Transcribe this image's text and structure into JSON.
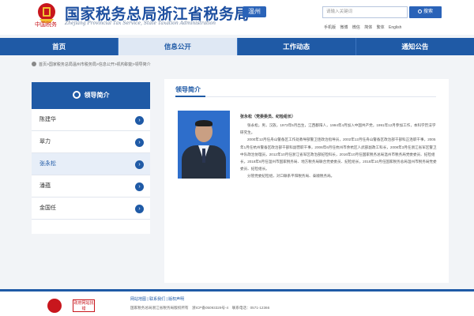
{
  "header": {
    "site_title": "国家税务总局浙江省税务局",
    "site_title_en": "Zhejiang Provincial Tax Service, State Taxation Administration",
    "brand_script": "中国税务",
    "city_badge": "温州",
    "search_placeholder": "请输入关键词",
    "search_button": "搜索",
    "quick_links": [
      "手机版",
      "微博",
      "微信",
      "简体",
      "繁体",
      "English"
    ]
  },
  "nav": {
    "items": [
      {
        "label": "首页",
        "active": false
      },
      {
        "label": "信息公开",
        "active": true
      },
      {
        "label": "工作动态",
        "active": false
      },
      {
        "label": "通知公告",
        "active": false
      }
    ]
  },
  "breadcrumb": "首页>国家税务总局温州市税务局>信息公开>机构职能>领导简介",
  "sidebar": {
    "title": "领导简介",
    "items": [
      {
        "label": "陈建华",
        "active": false
      },
      {
        "label": "翠力",
        "active": false
      },
      {
        "label": "张永松",
        "active": true
      },
      {
        "label": "潘蕴",
        "active": false
      },
      {
        "label": "金国任",
        "active": false
      }
    ]
  },
  "main": {
    "title": "领导简介",
    "bio_name": "张永松（党委委员、纪检组长）",
    "bio_paragraphs": [
      "张永松，男，汉族，1973年5月出生，江西鄱阳人，1994年4月加入中国共产党，1991年12月参加工作，本科学历法学研究生。",
      "2000年12月任舟山警备区工作处教导部警卫连政治指导员，2002年12月任舟山警备区政治部干部科正连职干事，2005年1月任杭州警备区政治部干部科副营职干事，2006年6月任杭州市余杭区人武部副政工科长，2008年3月任浙江省军区警卫中队政治协理员，2012年10月任浙江省军区政治部纪检科长，2016年10月任国家税务总局温州市税务局党委委员、纪检组长，2018年6月任温州市国家税务局、地方税务局联合党委委员、纪检组长，2018年10月任国家税务总局温州市税务局党委委员、纪检组长。",
      "分管党委纪检组，对口联系平阳税务局、泰顺税务局。"
    ]
  },
  "footer": {
    "links": "网站地图 | 联系我们 | 版权声明",
    "copyright": "国家税务总局浙江省税务局版权所有　浙ICP备05093329号-4　联系电话：0571-12366",
    "badge": "政府网站找错"
  }
}
